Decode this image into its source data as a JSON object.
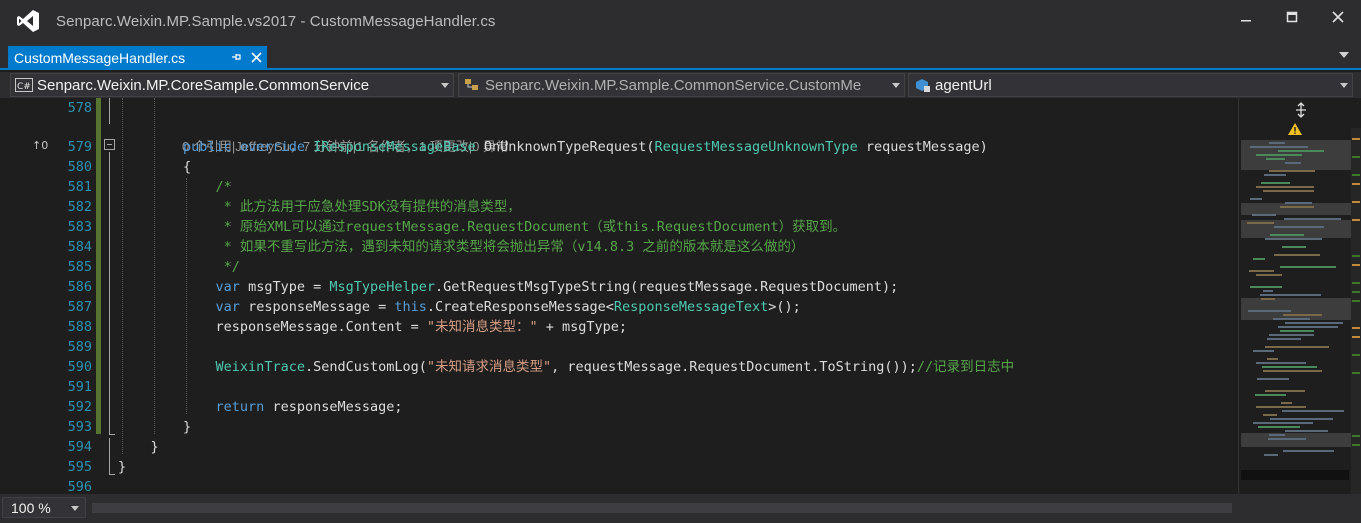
{
  "window": {
    "title": "Senparc.Weixin.MP.Sample.vs2017 - CustomMessageHandler.cs",
    "minimize_glyph": "🗕",
    "maximize_glyph": "🗖",
    "close_glyph": "✕"
  },
  "tab": {
    "label": "CustomMessageHandler.cs",
    "pin_glyph": "⊣",
    "close_glyph": "✕"
  },
  "navbar": {
    "project": "Senparc.Weixin.MP.CoreSample.CommonService",
    "project_icon": "C#",
    "class": "Senparc.Weixin.MP.Sample.CommonService.CustomMe",
    "member": "agentUrl"
  },
  "editor": {
    "codelens": "0 个引用|JeffreySu，7 分钟前|1 名作者，1 项更改|0 异常",
    "ref_indicator": "↑0",
    "lines": [
      {
        "num": "578",
        "parts": []
      },
      {
        "num": "579",
        "parts": [
          {
            "t": "        ",
            "c": ""
          },
          {
            "t": "public",
            "c": "kw"
          },
          {
            "t": " ",
            "c": ""
          },
          {
            "t": "override",
            "c": "kw"
          },
          {
            "t": " ",
            "c": ""
          },
          {
            "t": "IResponseMessageBase",
            "c": "ty"
          },
          {
            "t": " OnUnknownTypeRequest(",
            "c": ""
          },
          {
            "t": "RequestMessageUnknownType",
            "c": "ty"
          },
          {
            "t": " requestMessage)",
            "c": ""
          }
        ]
      },
      {
        "num": "580",
        "parts": [
          {
            "t": "        {",
            "c": ""
          }
        ]
      },
      {
        "num": "581",
        "parts": [
          {
            "t": "            /*",
            "c": "cm"
          }
        ]
      },
      {
        "num": "582",
        "parts": [
          {
            "t": "             * 此方法用于应急处理SDK没有提供的消息类型，",
            "c": "cm"
          }
        ]
      },
      {
        "num": "583",
        "parts": [
          {
            "t": "             * 原始XML可以通过requestMessage.RequestDocument（或this.RequestDocument）获取到。",
            "c": "cm"
          }
        ]
      },
      {
        "num": "584",
        "parts": [
          {
            "t": "             * 如果不重写此方法，遇到未知的请求类型将会抛出异常（v14.8.3 之前的版本就是这么做的）",
            "c": "cm"
          }
        ]
      },
      {
        "num": "585",
        "parts": [
          {
            "t": "             */",
            "c": "cm"
          }
        ]
      },
      {
        "num": "586",
        "parts": [
          {
            "t": "            ",
            "c": ""
          },
          {
            "t": "var",
            "c": "kw"
          },
          {
            "t": " msgType = ",
            "c": ""
          },
          {
            "t": "MsgTypeHelper",
            "c": "ty"
          },
          {
            "t": ".GetRequestMsgTypeString(requestMessage.RequestDocument);",
            "c": ""
          }
        ]
      },
      {
        "num": "587",
        "parts": [
          {
            "t": "            ",
            "c": ""
          },
          {
            "t": "var",
            "c": "kw"
          },
          {
            "t": " responseMessage = ",
            "c": ""
          },
          {
            "t": "this",
            "c": "kw"
          },
          {
            "t": ".CreateResponseMessage<",
            "c": ""
          },
          {
            "t": "ResponseMessageText",
            "c": "ty"
          },
          {
            "t": ">();",
            "c": ""
          }
        ]
      },
      {
        "num": "588",
        "parts": [
          {
            "t": "            responseMessage.Content = ",
            "c": ""
          },
          {
            "t": "\"未知消息类型：\"",
            "c": "st"
          },
          {
            "t": " + msgType;",
            "c": ""
          }
        ]
      },
      {
        "num": "589",
        "parts": []
      },
      {
        "num": "590",
        "parts": [
          {
            "t": "            ",
            "c": ""
          },
          {
            "t": "WeixinTrace",
            "c": "ty"
          },
          {
            "t": ".SendCustomLog(",
            "c": ""
          },
          {
            "t": "\"未知请求消息类型\"",
            "c": "st"
          },
          {
            "t": ", requestMessage.RequestDocument.ToString());",
            "c": ""
          },
          {
            "t": "//记录到日志中",
            "c": "cm"
          }
        ]
      },
      {
        "num": "591",
        "parts": []
      },
      {
        "num": "592",
        "parts": [
          {
            "t": "            ",
            "c": ""
          },
          {
            "t": "return",
            "c": "kw"
          },
          {
            "t": " responseMessage;",
            "c": ""
          }
        ]
      },
      {
        "num": "593",
        "parts": [
          {
            "t": "        }",
            "c": ""
          }
        ]
      },
      {
        "num": "594",
        "parts": [
          {
            "t": "    }",
            "c": ""
          }
        ]
      },
      {
        "num": "595",
        "parts": [
          {
            "t": "}",
            "c": ""
          }
        ]
      },
      {
        "num": "596",
        "parts": []
      }
    ]
  },
  "minimap": {
    "split_icon": "split-handle-icon",
    "warning_icon": "warning-icon"
  },
  "statusbar": {
    "zoom": "100 %"
  }
}
